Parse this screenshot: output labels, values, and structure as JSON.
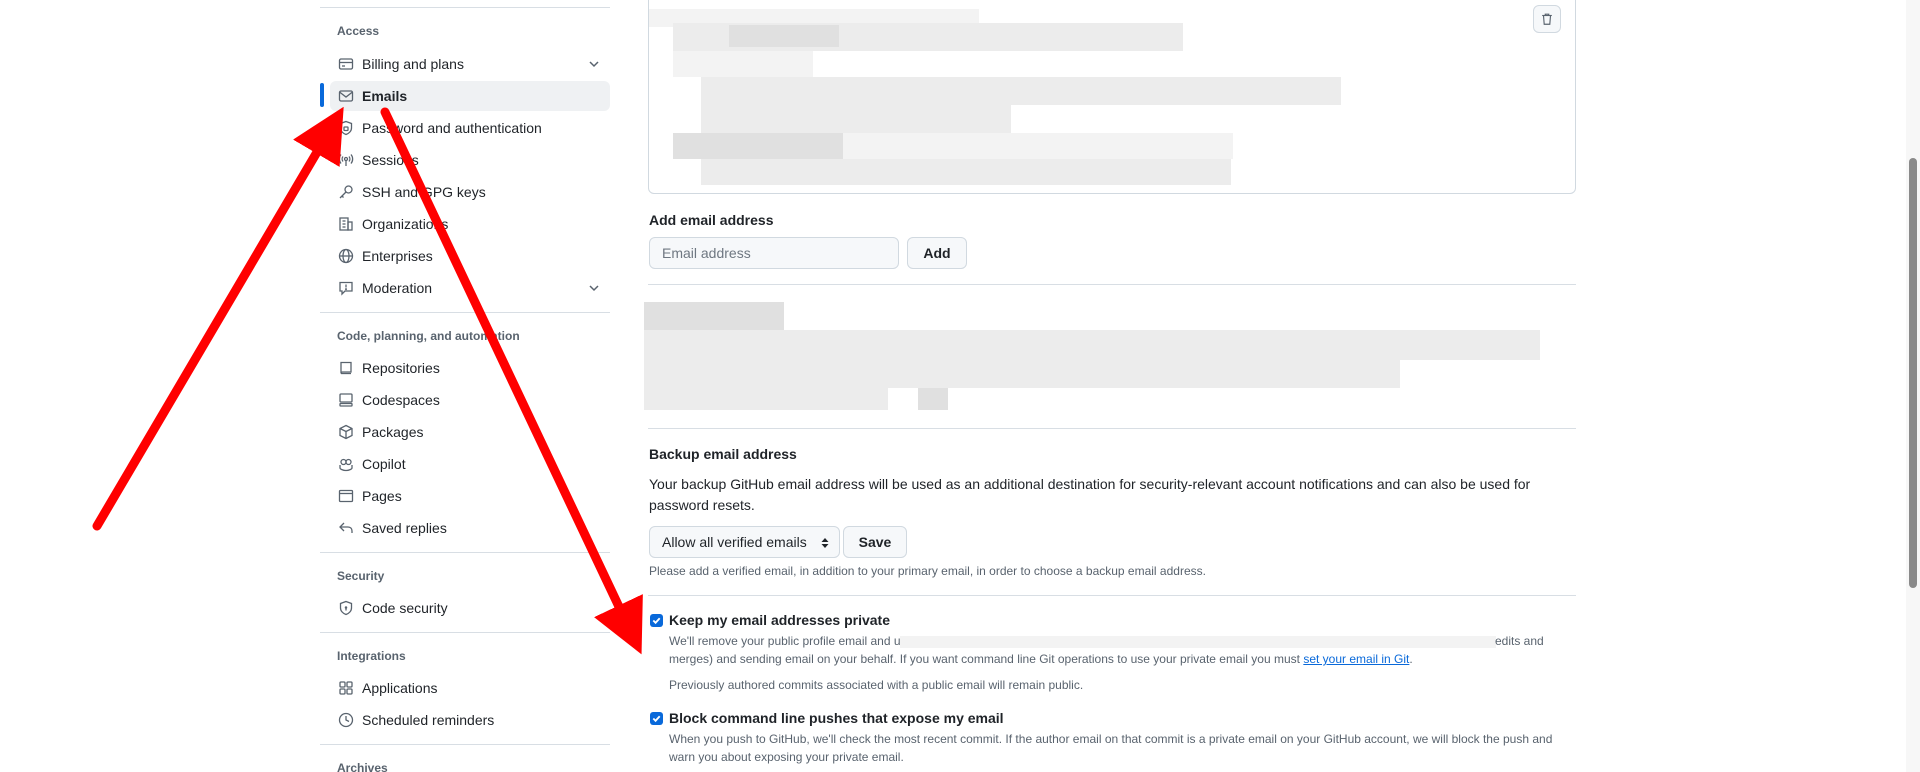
{
  "sidebar": {
    "sections": [
      {
        "heading": "Access",
        "items": [
          {
            "label": "Billing and plans",
            "icon": "credit-card-icon",
            "expandable": true
          },
          {
            "label": "Emails",
            "icon": "mail-icon",
            "active": true
          },
          {
            "label": "Password and authentication",
            "icon": "shield-lock-icon"
          },
          {
            "label": "Sessions",
            "icon": "broadcast-icon"
          },
          {
            "label": "SSH and GPG keys",
            "icon": "key-icon"
          },
          {
            "label": "Organizations",
            "icon": "organization-icon"
          },
          {
            "label": "Enterprises",
            "icon": "globe-icon"
          },
          {
            "label": "Moderation",
            "icon": "report-icon",
            "expandable": true
          }
        ]
      },
      {
        "heading": "Code, planning, and automation",
        "items": [
          {
            "label": "Repositories",
            "icon": "repo-icon"
          },
          {
            "label": "Codespaces",
            "icon": "codespaces-icon"
          },
          {
            "label": "Packages",
            "icon": "package-icon"
          },
          {
            "label": "Copilot",
            "icon": "copilot-icon"
          },
          {
            "label": "Pages",
            "icon": "browser-icon"
          },
          {
            "label": "Saved replies",
            "icon": "reply-icon"
          }
        ]
      },
      {
        "heading": "Security",
        "items": [
          {
            "label": "Code security",
            "icon": "shield-check-icon"
          }
        ]
      },
      {
        "heading": "Integrations",
        "items": [
          {
            "label": "Applications",
            "icon": "apps-icon"
          },
          {
            "label": "Scheduled reminders",
            "icon": "clock-icon"
          }
        ]
      },
      {
        "heading": "Archives",
        "items": []
      }
    ]
  },
  "main": {
    "add_email": {
      "label": "Add email address",
      "placeholder": "Email address",
      "button": "Add"
    },
    "backup": {
      "title": "Backup email address",
      "description": "Your backup GitHub email address will be used as an additional destination for security-relevant account notifications and can also be used for password resets.",
      "select_value": "Allow all verified emails",
      "save_button": "Save",
      "note": "Please add a verified email, in addition to your primary email, in order to choose a backup email address."
    },
    "keep_private": {
      "checked": true,
      "title": "Keep my email addresses private",
      "desc_start": "We'll remove your public profile email and u",
      "desc_end": "edits and",
      "desc_line2_prefix": "merges) and sending email on your behalf. If you want command line Git operations to use your private email you must ",
      "desc_link": "set your email in Git",
      "desc_line2_suffix": ".",
      "note": "Previously authored commits associated with a public email will remain public."
    },
    "block_pushes": {
      "checked": true,
      "title": "Block command line pushes that expose my email",
      "desc_line1": "When you push to GitHub, we'll check the most recent commit. If the author email on that commit is a private email on your GitHub account, we will block the push and",
      "desc_line2": "warn you about exposing your private email."
    }
  },
  "colors": {
    "accent": "#0969da",
    "annotation_arrow": "#ff0000",
    "active_bg": "#eff1f3"
  }
}
